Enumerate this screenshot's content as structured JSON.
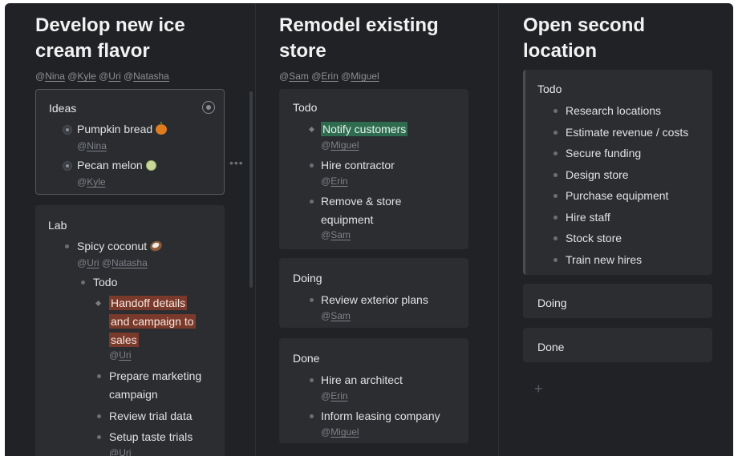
{
  "projects": [
    {
      "title_line1": "Develop new ice",
      "title_line2": "cream flavor",
      "members": [
        "@Nina",
        "@Kyle",
        "@Uri",
        "@Natasha"
      ],
      "cards": {
        "ideas": {
          "title": "Ideas",
          "items": [
            {
              "text": "Pumpkin bread",
              "emoji": "pumpkin-emoji",
              "assignee": "@Nina"
            },
            {
              "text": "Pecan melon",
              "emoji": "melon-emoji",
              "assignee": "@Kyle"
            }
          ]
        },
        "lab": {
          "title": "Lab",
          "item": {
            "text": "Spicy coconut",
            "emoji": "coconut-emoji",
            "assignees": [
              "@Uri",
              "@Natasha"
            ]
          },
          "todo_label": "Todo",
          "todos": [
            {
              "lines": [
                "Handoff details",
                "and campaign to",
                "sales"
              ],
              "assignee": "@Uri",
              "highlight": "#7a3a2b"
            },
            {
              "lines": [
                "Prepare marketing",
                "campaign"
              ]
            },
            {
              "lines": [
                "Review trial data"
              ]
            },
            {
              "lines": [
                "Setup taste trials"
              ],
              "assignee": "@Uri"
            }
          ]
        }
      }
    },
    {
      "title_line1": "Remodel existing",
      "title_line2": "store",
      "members": [
        "@Sam",
        "@Erin",
        "@Miguel"
      ],
      "cards": {
        "todo": {
          "title": "Todo",
          "items": [
            {
              "text": "Notify customers",
              "assignee": "@Miguel",
              "highlight": "#2f6b4f"
            },
            {
              "text": "Hire contractor",
              "assignee": "@Erin"
            },
            {
              "line1": "Remove & store",
              "line2": "equipment",
              "assignee": "@Sam"
            }
          ]
        },
        "doing": {
          "title": "Doing",
          "items": [
            {
              "text": "Review exterior plans",
              "assignee": "@Sam"
            }
          ]
        },
        "done": {
          "title": "Done",
          "items": [
            {
              "text": "Hire an architect",
              "assignee": "@Erin"
            },
            {
              "text": "Inform leasing company",
              "assignee": "@Miguel"
            }
          ]
        }
      }
    },
    {
      "title_line1": "Open second",
      "title_line2": "location",
      "cards": {
        "todo": {
          "title": "Todo",
          "items": [
            "Research locations",
            "Estimate revenue / costs",
            "Secure funding",
            "Design store",
            "Purchase equipment",
            "Hire staff",
            "Stock store",
            "Train new hires"
          ]
        },
        "doing": {
          "title": "Doing"
        },
        "done": {
          "title": "Done"
        }
      },
      "add_label": "+"
    }
  ]
}
